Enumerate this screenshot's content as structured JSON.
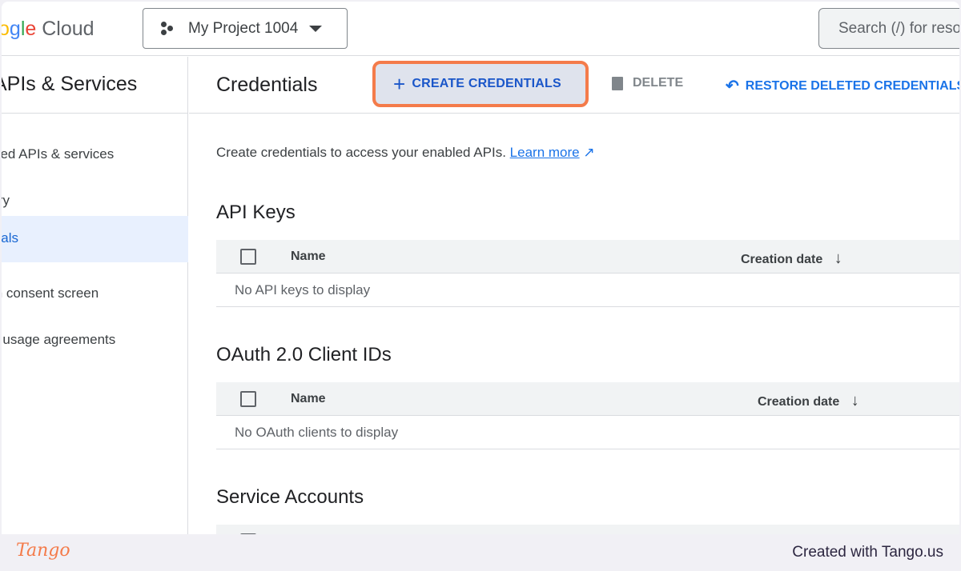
{
  "header": {
    "logo": "Google Cloud",
    "project": "My Project 1004",
    "search_placeholder": "Search (/) for resources"
  },
  "sidebar": {
    "title": "APIs & Services",
    "items": [
      {
        "label": "Enabled APIs & services"
      },
      {
        "label": "Library"
      },
      {
        "label": "Credentials",
        "active": true
      },
      {
        "label": "OAuth consent screen"
      },
      {
        "label": "Page usage agreements"
      }
    ]
  },
  "toolbar": {
    "title": "Credentials",
    "create": "CREATE CREDENTIALS",
    "delete": "DELETE",
    "restore": "RESTORE DELETED CREDENTIALS"
  },
  "main": {
    "description": "Create credentials to access your enabled APIs.",
    "learn_more": "Learn more",
    "api_keys": {
      "title": "API Keys",
      "col_name": "Name",
      "col_date": "Creation date",
      "empty": "No API keys to display"
    },
    "oauth": {
      "title": "OAuth 2.0 Client IDs",
      "col_name": "Name",
      "col_date": "Creation date",
      "empty": "No OAuth clients to display"
    },
    "service": {
      "title": "Service Accounts"
    }
  },
  "footer": {
    "brand": "Tango",
    "credit": "Created with Tango.us"
  },
  "colors": {
    "highlight": "#f47b4a",
    "accent": "#1a73e8"
  }
}
